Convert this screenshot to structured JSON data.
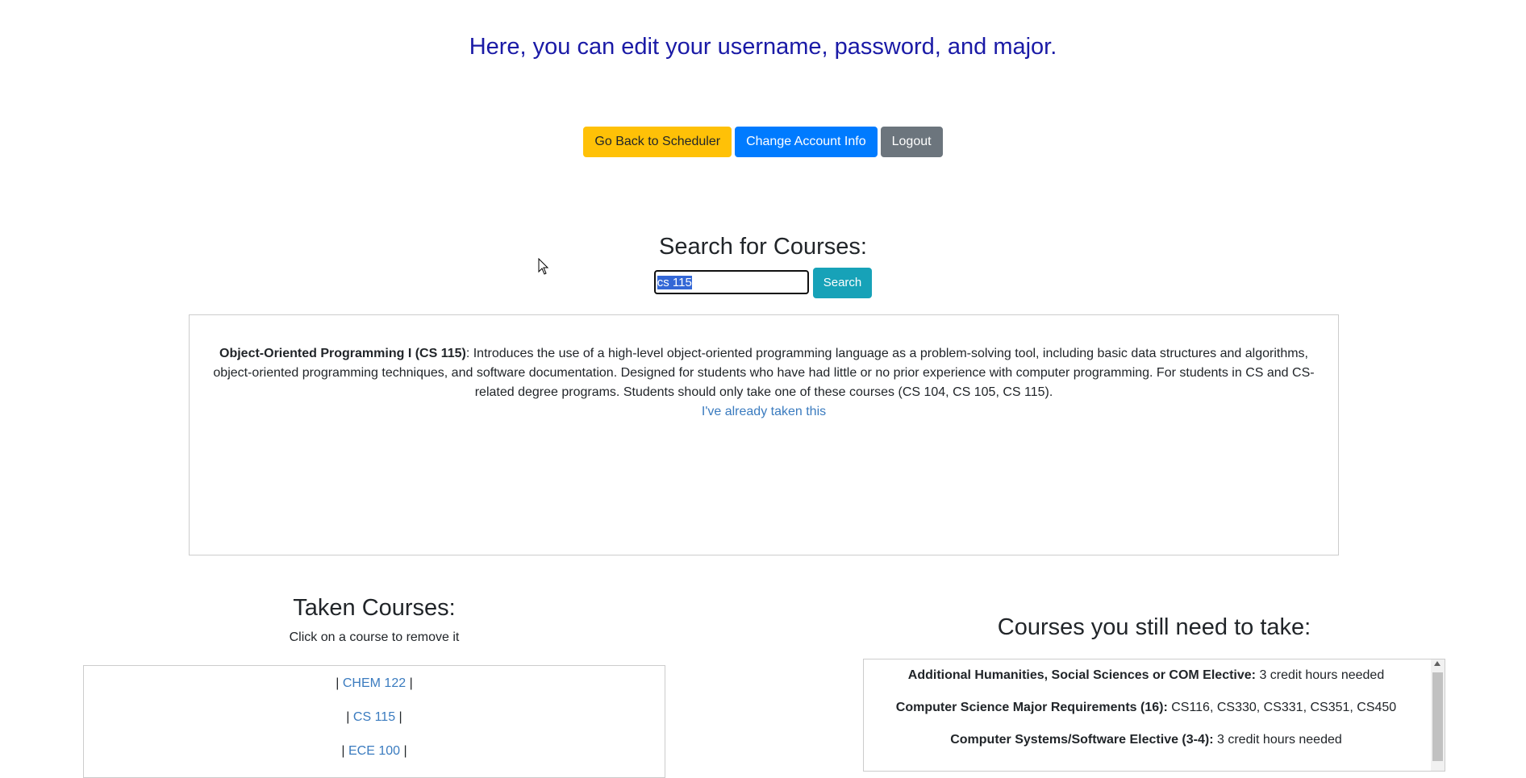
{
  "header": {
    "headline": "Here, you can edit your username, password, and major."
  },
  "nav_buttons": {
    "back": "Go Back to Scheduler",
    "account": "Change Account Info",
    "logout": "Logout"
  },
  "search": {
    "title": "Search for Courses:",
    "value": "cs 115",
    "button": "Search"
  },
  "result": {
    "course_title": "Object-Oriented Programming I (CS 115)",
    "description": ": Introduces the use of a high-level object-oriented programming language as a problem-solving tool, including basic data structures and algorithms, object-oriented programming techniques, and software documentation. Designed for students who have had little or no prior experience with computer programming. For students in CS and CS-related degree programs. Students should only take one of these courses (CS 104, CS 105, CS 115).",
    "taken_link": "I've already taken this"
  },
  "taken": {
    "title": "Taken Courses:",
    "hint": "Click on a course to remove it",
    "separator": "|",
    "courses": [
      "CHEM 122",
      "CS 115",
      "ECE 100"
    ]
  },
  "needed": {
    "title": "Courses you still need to take:",
    "items": [
      {
        "label": "Additional Humanities, Social Sciences or COM Elective:",
        "detail": "3 credit hours needed"
      },
      {
        "label": "Computer Science Major Requirements (16):",
        "detail": "CS116, CS330, CS331, CS351, CS450"
      },
      {
        "label": "Computer Systems/Software Elective (3-4):",
        "detail": "3 credit hours needed"
      }
    ]
  },
  "colors": {
    "headline": "#1a1aa6",
    "warning": "#ffc107",
    "primary": "#007bff",
    "secondary": "#6c757d",
    "info": "#17a2b8",
    "link": "#3a7bbf"
  }
}
